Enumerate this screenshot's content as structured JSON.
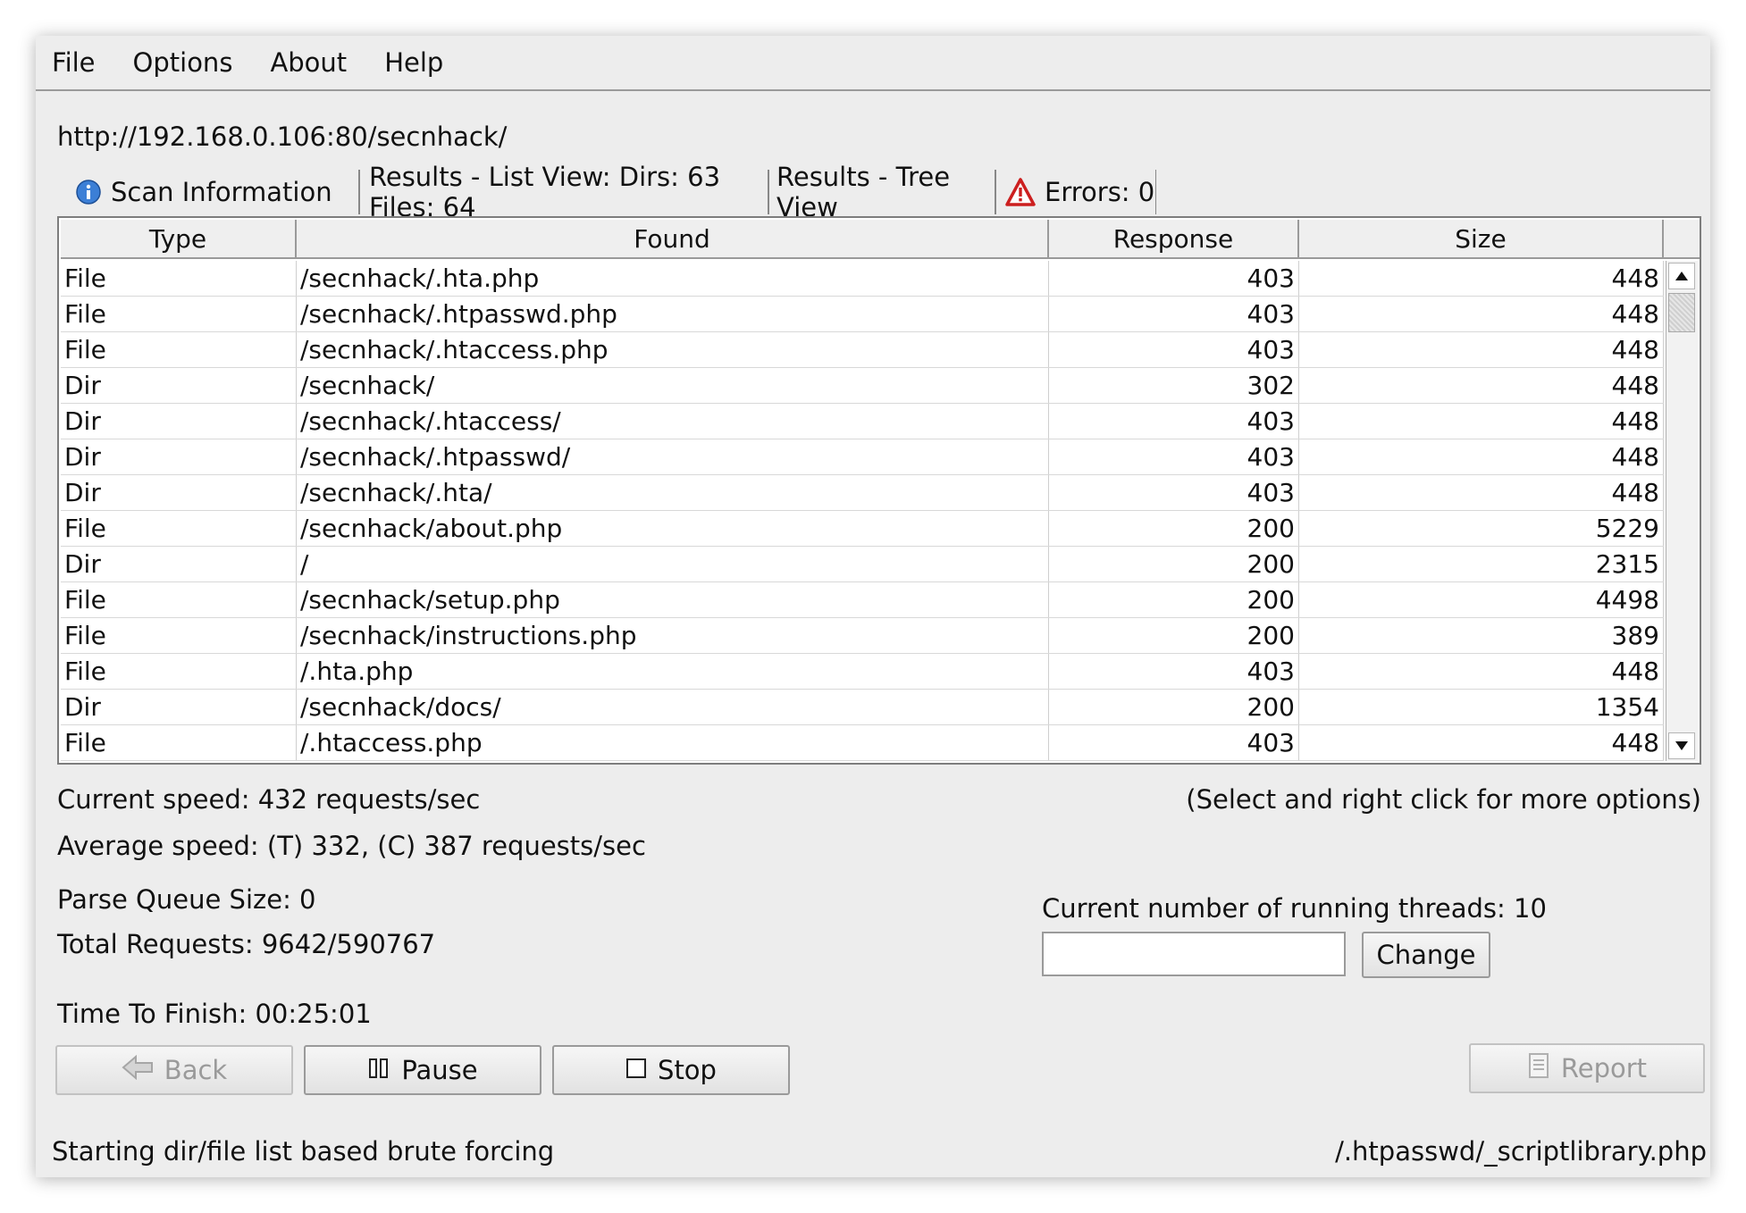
{
  "menu": [
    "File",
    "Options",
    "About",
    "Help"
  ],
  "url": "http://192.168.0.106:80/secnhack/",
  "tabs": {
    "scan_info": "Scan Information",
    "list_view": "Results - List View: Dirs: 63 Files: 64",
    "tree_view": "Results - Tree View",
    "errors": "Errors: 0"
  },
  "table": {
    "headers": [
      "Type",
      "Found",
      "Response",
      "Size"
    ],
    "rows": [
      {
        "type": "File",
        "found": "/secnhack/.hta.php",
        "response": "403",
        "size": "448"
      },
      {
        "type": "File",
        "found": "/secnhack/.htpasswd.php",
        "response": "403",
        "size": "448"
      },
      {
        "type": "File",
        "found": "/secnhack/.htaccess.php",
        "response": "403",
        "size": "448"
      },
      {
        "type": "Dir",
        "found": "/secnhack/",
        "response": "302",
        "size": "448"
      },
      {
        "type": "Dir",
        "found": "/secnhack/.htaccess/",
        "response": "403",
        "size": "448"
      },
      {
        "type": "Dir",
        "found": "/secnhack/.htpasswd/",
        "response": "403",
        "size": "448"
      },
      {
        "type": "Dir",
        "found": "/secnhack/.hta/",
        "response": "403",
        "size": "448"
      },
      {
        "type": "File",
        "found": "/secnhack/about.php",
        "response": "200",
        "size": "5229"
      },
      {
        "type": "Dir",
        "found": "/",
        "response": "200",
        "size": "2315"
      },
      {
        "type": "File",
        "found": "/secnhack/setup.php",
        "response": "200",
        "size": "4498"
      },
      {
        "type": "File",
        "found": "/secnhack/instructions.php",
        "response": "200",
        "size": "389"
      },
      {
        "type": "File",
        "found": "/.hta.php",
        "response": "403",
        "size": "448"
      },
      {
        "type": "Dir",
        "found": "/secnhack/docs/",
        "response": "200",
        "size": "1354"
      },
      {
        "type": "File",
        "found": "/.htaccess.php",
        "response": "403",
        "size": "448"
      }
    ]
  },
  "stats": {
    "current_speed": "Current speed: 432 requests/sec",
    "hint": "(Select and right click for more options)",
    "average_speed": "Average speed: (T) 332, (C) 387 requests/sec",
    "parse_queue": "Parse Queue Size: 0",
    "total_requests": "Total Requests: 9642/590767",
    "threads": "Current number of running threads: 10",
    "time_to_finish": "Time To Finish: 00:25:01"
  },
  "threads_input_value": "",
  "buttons": {
    "change": "Change",
    "back": "Back",
    "pause": "Pause",
    "stop": "Stop",
    "report": "Report"
  },
  "status": {
    "left": "Starting dir/file list based brute forcing",
    "right": "/.htpasswd/_scriptlibrary.php"
  },
  "icons": {
    "info": "info-icon",
    "warning": "warning-icon",
    "back": "back-arrow-icon",
    "pause": "pause-icon",
    "stop": "stop-icon",
    "report": "report-icon"
  },
  "colors": {
    "info_blue": "#3c7fd6",
    "warning_red": "#cc1f1f"
  }
}
